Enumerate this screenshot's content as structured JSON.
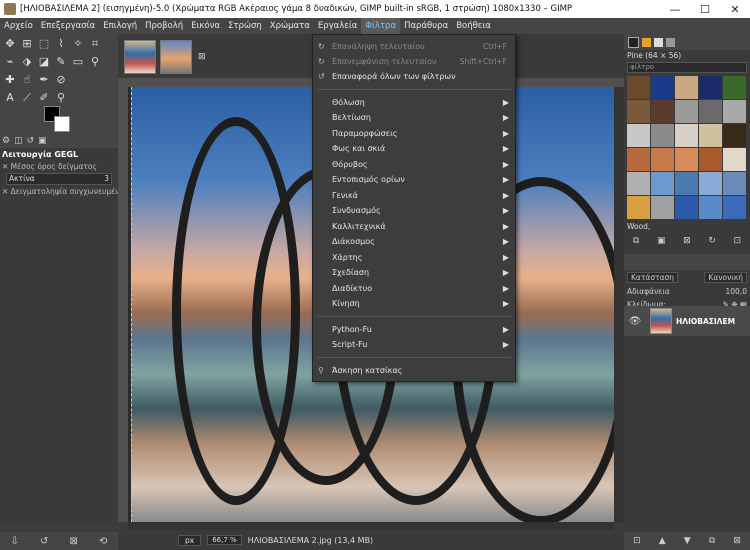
{
  "window": {
    "title": "[ΗΛΙΟΒΑΣΙΛΕΜΑ 2] (εισηγμένη)-5.0 (Χρώματα RGB Ακέραιος γάμα 8 δυαδικών, GIMP built-in sRGB, 1 στρώση) 1080x1330 – GIMP",
    "minimize": "—",
    "maximize": "☐",
    "close": "✕"
  },
  "menubar": [
    "Αρχείο",
    "Επεξεργασία",
    "Επιλογή",
    "Προβολή",
    "Εικόνα",
    "Στρώση",
    "Χρώματα",
    "Εργαλεία",
    "Φίλτρα",
    "Παράθυρα",
    "Βοήθεια"
  ],
  "active_menu": "Φίλτρα",
  "filters_menu": {
    "top_items": [
      {
        "label": "Επανάληψη τελευταίου",
        "shortcut": "Ctrl+F",
        "disabled": true
      },
      {
        "label": "Επανεμφάνιση τελευταίου",
        "shortcut": "Shift+Ctrl+F",
        "disabled": true
      },
      {
        "label": "Επαναφορά όλων των φίλτρων",
        "shortcut": "",
        "disabled": false
      }
    ],
    "submenus": [
      "Θόλωση",
      "Βελτίωση",
      "Παραμορφώσεις",
      "Φως και σκιά",
      "Θόρυβος",
      "Εντοπισμός ορίων",
      "Γενικά",
      "Συνδυασμός",
      "Καλλιτεχνικά",
      "Διάκοσμος",
      "Χάρτης",
      "Σχεδίαση",
      "Διαδίκτυο",
      "Κίνηση"
    ],
    "script_items": [
      "Python-Fu",
      "Script-Fu"
    ],
    "bottom_item": "Άσκηση κατσίκας"
  },
  "tool_options": {
    "title": "Λειτουργία GEGL",
    "sample_label": "Μέσος όρος δείγματος",
    "radius_label": "Ακτίνα",
    "radius_value": "3",
    "sample_merged": "Δειγματοληψία συγχωνευμένων"
  },
  "status": {
    "unit": "px",
    "zoom": "66,7 %",
    "file": "ΗΛΙΟΒΑΣΙΛΕΜΑ 2.jpg (13,4 MB)"
  },
  "patterns_panel": {
    "title": "Pine (64 × 56)",
    "filter_placeholder": "φίλτρο",
    "selected_label": "Wood,"
  },
  "layers_panel": {
    "mode_label": "Κατάσταση",
    "mode_value": "Κανονική",
    "opacity_label": "Αδιαφάνεια",
    "opacity_value": "100,0",
    "lock_label": "Κλείδωμα:",
    "layer_name": "ΗΛΙΟΒΑΣΙΛΕΜ"
  },
  "colors": {
    "menu_bg": "#3d3d3d",
    "active_menu_text": "#7fc3ff",
    "ui_bg": "#3a3a3a"
  }
}
